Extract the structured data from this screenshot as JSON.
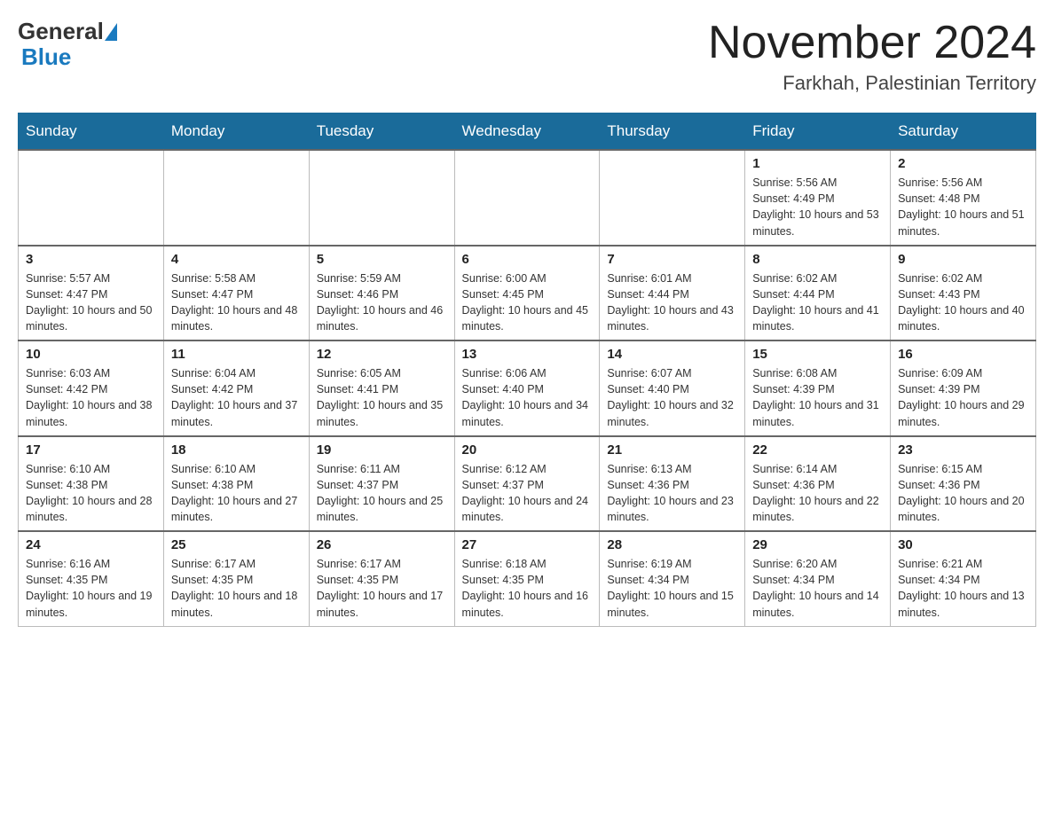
{
  "header": {
    "logo_general": "General",
    "logo_blue": "Blue",
    "month_title": "November 2024",
    "location": "Farkhah, Palestinian Territory"
  },
  "calendar": {
    "days_of_week": [
      "Sunday",
      "Monday",
      "Tuesday",
      "Wednesday",
      "Thursday",
      "Friday",
      "Saturday"
    ],
    "weeks": [
      [
        {
          "day": "",
          "info": ""
        },
        {
          "day": "",
          "info": ""
        },
        {
          "day": "",
          "info": ""
        },
        {
          "day": "",
          "info": ""
        },
        {
          "day": "",
          "info": ""
        },
        {
          "day": "1",
          "info": "Sunrise: 5:56 AM\nSunset: 4:49 PM\nDaylight: 10 hours and 53 minutes."
        },
        {
          "day": "2",
          "info": "Sunrise: 5:56 AM\nSunset: 4:48 PM\nDaylight: 10 hours and 51 minutes."
        }
      ],
      [
        {
          "day": "3",
          "info": "Sunrise: 5:57 AM\nSunset: 4:47 PM\nDaylight: 10 hours and 50 minutes."
        },
        {
          "day": "4",
          "info": "Sunrise: 5:58 AM\nSunset: 4:47 PM\nDaylight: 10 hours and 48 minutes."
        },
        {
          "day": "5",
          "info": "Sunrise: 5:59 AM\nSunset: 4:46 PM\nDaylight: 10 hours and 46 minutes."
        },
        {
          "day": "6",
          "info": "Sunrise: 6:00 AM\nSunset: 4:45 PM\nDaylight: 10 hours and 45 minutes."
        },
        {
          "day": "7",
          "info": "Sunrise: 6:01 AM\nSunset: 4:44 PM\nDaylight: 10 hours and 43 minutes."
        },
        {
          "day": "8",
          "info": "Sunrise: 6:02 AM\nSunset: 4:44 PM\nDaylight: 10 hours and 41 minutes."
        },
        {
          "day": "9",
          "info": "Sunrise: 6:02 AM\nSunset: 4:43 PM\nDaylight: 10 hours and 40 minutes."
        }
      ],
      [
        {
          "day": "10",
          "info": "Sunrise: 6:03 AM\nSunset: 4:42 PM\nDaylight: 10 hours and 38 minutes."
        },
        {
          "day": "11",
          "info": "Sunrise: 6:04 AM\nSunset: 4:42 PM\nDaylight: 10 hours and 37 minutes."
        },
        {
          "day": "12",
          "info": "Sunrise: 6:05 AM\nSunset: 4:41 PM\nDaylight: 10 hours and 35 minutes."
        },
        {
          "day": "13",
          "info": "Sunrise: 6:06 AM\nSunset: 4:40 PM\nDaylight: 10 hours and 34 minutes."
        },
        {
          "day": "14",
          "info": "Sunrise: 6:07 AM\nSunset: 4:40 PM\nDaylight: 10 hours and 32 minutes."
        },
        {
          "day": "15",
          "info": "Sunrise: 6:08 AM\nSunset: 4:39 PM\nDaylight: 10 hours and 31 minutes."
        },
        {
          "day": "16",
          "info": "Sunrise: 6:09 AM\nSunset: 4:39 PM\nDaylight: 10 hours and 29 minutes."
        }
      ],
      [
        {
          "day": "17",
          "info": "Sunrise: 6:10 AM\nSunset: 4:38 PM\nDaylight: 10 hours and 28 minutes."
        },
        {
          "day": "18",
          "info": "Sunrise: 6:10 AM\nSunset: 4:38 PM\nDaylight: 10 hours and 27 minutes."
        },
        {
          "day": "19",
          "info": "Sunrise: 6:11 AM\nSunset: 4:37 PM\nDaylight: 10 hours and 25 minutes."
        },
        {
          "day": "20",
          "info": "Sunrise: 6:12 AM\nSunset: 4:37 PM\nDaylight: 10 hours and 24 minutes."
        },
        {
          "day": "21",
          "info": "Sunrise: 6:13 AM\nSunset: 4:36 PM\nDaylight: 10 hours and 23 minutes."
        },
        {
          "day": "22",
          "info": "Sunrise: 6:14 AM\nSunset: 4:36 PM\nDaylight: 10 hours and 22 minutes."
        },
        {
          "day": "23",
          "info": "Sunrise: 6:15 AM\nSunset: 4:36 PM\nDaylight: 10 hours and 20 minutes."
        }
      ],
      [
        {
          "day": "24",
          "info": "Sunrise: 6:16 AM\nSunset: 4:35 PM\nDaylight: 10 hours and 19 minutes."
        },
        {
          "day": "25",
          "info": "Sunrise: 6:17 AM\nSunset: 4:35 PM\nDaylight: 10 hours and 18 minutes."
        },
        {
          "day": "26",
          "info": "Sunrise: 6:17 AM\nSunset: 4:35 PM\nDaylight: 10 hours and 17 minutes."
        },
        {
          "day": "27",
          "info": "Sunrise: 6:18 AM\nSunset: 4:35 PM\nDaylight: 10 hours and 16 minutes."
        },
        {
          "day": "28",
          "info": "Sunrise: 6:19 AM\nSunset: 4:34 PM\nDaylight: 10 hours and 15 minutes."
        },
        {
          "day": "29",
          "info": "Sunrise: 6:20 AM\nSunset: 4:34 PM\nDaylight: 10 hours and 14 minutes."
        },
        {
          "day": "30",
          "info": "Sunrise: 6:21 AM\nSunset: 4:34 PM\nDaylight: 10 hours and 13 minutes."
        }
      ]
    ]
  }
}
